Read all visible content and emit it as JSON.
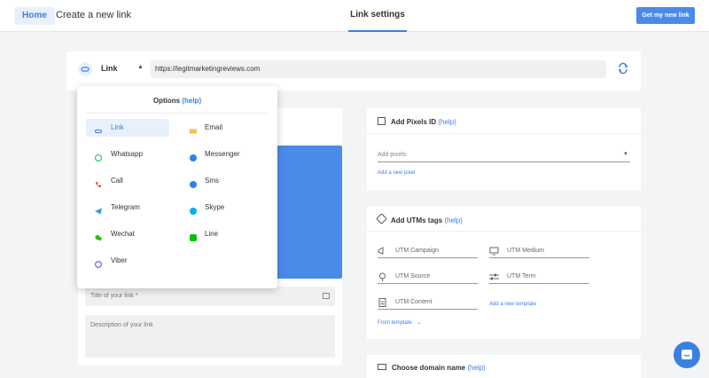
{
  "topbar": {
    "home_label": "Home",
    "page_title": "Create a new link",
    "center_tab": "Link settings",
    "cta_label": "Get my new link"
  },
  "linkbar": {
    "type_label": "Link",
    "url_value": "https://legitmarketingreviews.com"
  },
  "dropdown": {
    "title": "Options",
    "help": "(help)",
    "items": [
      {
        "label": "Link",
        "icon": "link-icon"
      },
      {
        "label": "Email",
        "icon": "email-icon"
      },
      {
        "label": "Whatsapp",
        "icon": "whatsapp-icon"
      },
      {
        "label": "Messenger",
        "icon": "messenger-icon"
      },
      {
        "label": "Call",
        "icon": "phone-icon"
      },
      {
        "label": "Sms",
        "icon": "sms-icon"
      },
      {
        "label": "Telegram",
        "icon": "telegram-icon"
      },
      {
        "label": "Skype",
        "icon": "skype-icon"
      },
      {
        "label": "Wechat",
        "icon": "wechat-icon"
      },
      {
        "label": "Line",
        "icon": "line-icon"
      },
      {
        "label": "Viber",
        "icon": "viber-icon"
      }
    ]
  },
  "form": {
    "title_placeholder": "Title of your link *",
    "desc_placeholder": "Description of your link"
  },
  "pixels": {
    "title": "Add Pixels ID",
    "help": "(help)",
    "select_placeholder": "Add pixels",
    "add_link": "Add a new pixel"
  },
  "utm": {
    "title": "Add UTMs tags",
    "help": "(help)",
    "campaign": "UTM Campaign",
    "medium": "UTM Medium",
    "source": "UTM Source",
    "term": "UTM Term",
    "content": "UTM Content",
    "add_template": "Add a new template",
    "from_template": "From template"
  },
  "domain": {
    "title": "Choose domain name",
    "help": "(help)"
  },
  "colors": {
    "accent": "#3b7fe0",
    "button": "#4a8bea",
    "background": "#f3f4f6"
  }
}
